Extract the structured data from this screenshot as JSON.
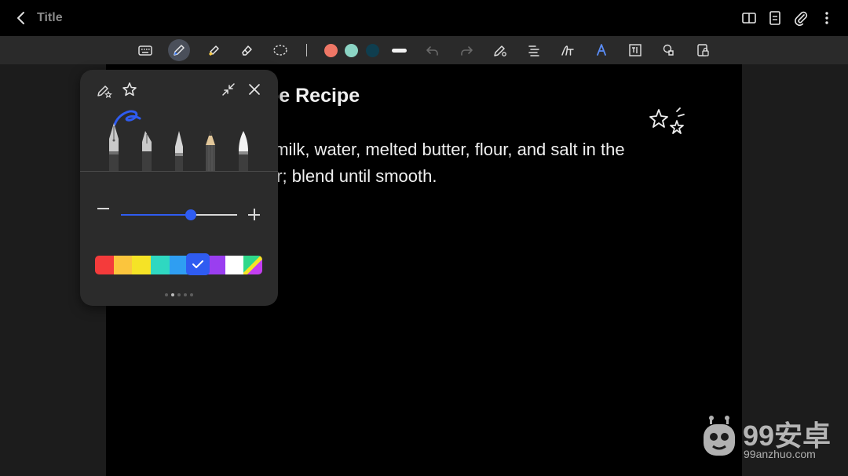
{
  "header": {
    "back_icon": "chevron-left-icon",
    "title": "Title",
    "actions": [
      "book-view-icon",
      "page-list-icon",
      "attach-icon",
      "more-vertical-icon"
    ]
  },
  "toolbar": {
    "tools": [
      "keyboard-icon",
      "pen-icon",
      "highlighter-icon",
      "eraser-icon",
      "lasso-icon"
    ],
    "active_tool": "pen-icon",
    "colors": [
      "#ef7766",
      "#8bd4c4",
      "#0f3e4f"
    ],
    "more_tools": [
      "undo-icon",
      "redo-icon",
      "pen-settings-icon",
      "text-align-icon",
      "handwriting-to-text-icon",
      "text-style-icon",
      "insert-text-icon",
      "shapes-icon",
      "lock-page-icon"
    ]
  },
  "document": {
    "title_visible": "pe Recipe",
    "line1_visible": ", milk, water, melted butter, flour, and salt in the",
    "line2_visible": "er; blend until smooth."
  },
  "pen_panel": {
    "icons": [
      "pen-favorite-icon",
      "star-icon",
      "collapse-icon",
      "close-icon"
    ],
    "pens": [
      "fountain-pen-icon",
      "calligraphy-pen-icon",
      "ballpoint-pen-icon",
      "pencil-icon",
      "brush-pen-icon"
    ],
    "size_level": 0.6,
    "palette": [
      "#f43b3b",
      "#fbc53d",
      "#f5e326",
      "#2fd8c1",
      "#2f9ef2",
      "#2f5cf1",
      "#9a3ef0",
      "#ffffff"
    ],
    "selected_color": "#2f5cf1",
    "page_count": 5,
    "current_page": 2
  },
  "watermark": {
    "text": "99安卓",
    "subtext": "99anzhuo.com"
  }
}
